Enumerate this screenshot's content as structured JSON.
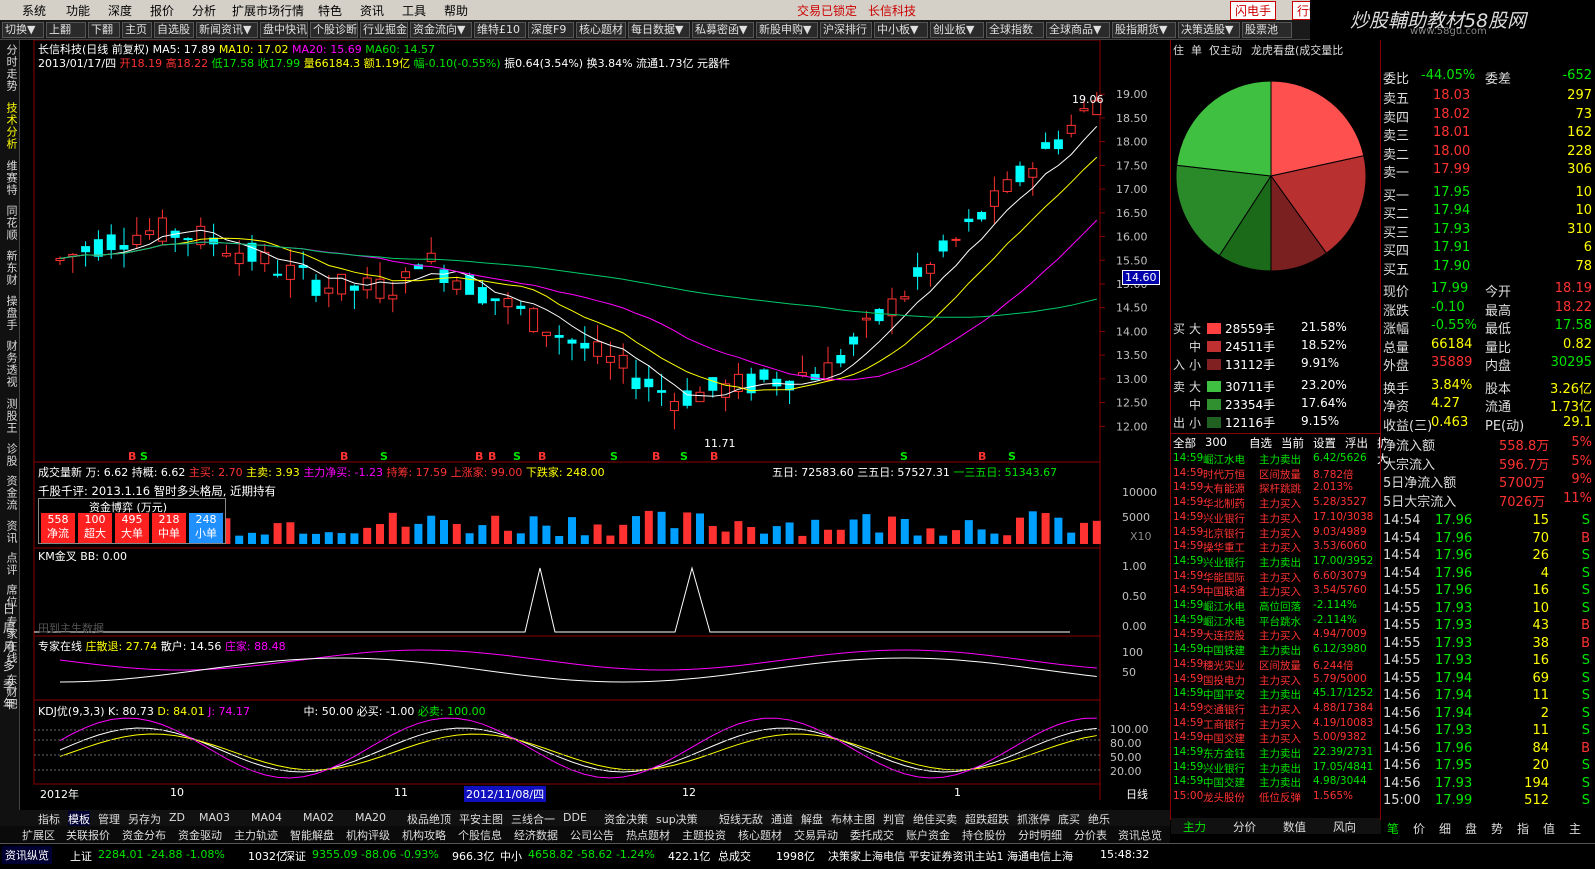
{
  "menu": [
    "系统",
    "功能",
    "深度",
    "报价",
    "分析",
    "扩展市场行情",
    "特色",
    "资讯",
    "工具",
    "帮助"
  ],
  "menu_right": {
    "trade_status": "交易已锁定",
    "stock_name": "长信科技",
    "flash": "闪电手",
    "action": "行情"
  },
  "brand": {
    "text": "炒股輔助教材58股网",
    "url": "www.58gu.com"
  },
  "toolbar": [
    "切换▼",
    "上翻",
    "下翻",
    "主页",
    "自选股",
    "新闻资讯▼",
    "盘中快讯",
    "个股诊断",
    "行业掘金",
    "资金流向▼",
    "维特£10",
    "深度F9",
    "核心题材",
    "每日数据▼",
    "私募密函▼",
    "新股申购▼",
    "沪深排行",
    "中小板▼",
    "创业板▼",
    "全球指数",
    "全球商品▼",
    "股指期货▼",
    "决策选股▼",
    "股票池"
  ],
  "side_tabs": [
    "分时走势",
    "技术分析",
    "维赛特",
    "同花顺",
    "新东财",
    "操盘手",
    "财务透视",
    "测股王",
    "诊股",
    "资金流",
    "资讯",
    "点评",
    "席位",
    "专家在线",
    "东财吧"
  ],
  "side_tabs2": [
    "日",
    "周",
    "月",
    "多",
    "季",
    "年"
  ],
  "chart": {
    "title_line": "长信科技(日线 前复权)",
    "ma5": "MA5: 17.89",
    "ma10": "MA10: 17.02",
    "ma20": "MA20: 15.69",
    "ma60": "MA60: 14.57",
    "info_date": "2013/01/17/四",
    "info_open": "开18.19",
    "info_high": "高18.22",
    "info_low": "低17.58",
    "info_close": "收17.99",
    "info_vol": "量66184.3",
    "info_amt": "额1.19亿",
    "info_chg": "幅-0.10(-0.55%)",
    "info_rest": "振0.64(3.54%) 换3.84% 流通1.73亿 元器件",
    "price_ticks": [
      "19.00",
      "18.50",
      "18.00",
      "17.50",
      "17.00",
      "16.50",
      "16.00",
      "15.50",
      "15.00",
      "14.50",
      "14.00",
      "13.50",
      "13.00",
      "12.50",
      "12.00"
    ],
    "current_price": "14.60",
    "max_label": "19.06",
    "min_label": "11.71",
    "vol_title": "成交量新",
    "vol_wan": "万: 6.62",
    "vol_hold": "持概: 6.62",
    "vol_main": "主买: 2.70",
    "vol_mainsell": "主卖: 3.93",
    "vol_net": "主力净买: -1.23",
    "vol_cash": "持筹: 17.59",
    "vol_up": "上涨家: 99.00",
    "vol_down": "下跌家: 248.00",
    "vol_5d": "五日: 72583.60",
    "vol_35d": "三五日: 57527.31",
    "vol_135d": "一三五日: 51343.67",
    "vol_ticks": [
      "10000",
      "5000"
    ],
    "vol_mult": "X10",
    "news_line": "千股千评: 2013.1.16 智时多头格局, 近期持有",
    "fund_box": {
      "title": "资金博弈 (万元)",
      "cells": [
        {
          "v": "558",
          "l": "净流"
        },
        {
          "v": "100",
          "l": "超大"
        },
        {
          "v": "495",
          "l": "大单"
        },
        {
          "v": "218",
          "l": "中单"
        },
        {
          "v": "248",
          "l": "小单"
        }
      ]
    },
    "km_title": "KM金叉",
    "km_bb": "BB: 0.00",
    "km_ticks": [
      "1.00",
      "0.50",
      "0.00"
    ],
    "km_note": "田到主生数据",
    "expert_title": "专家在线",
    "expert_zz": "庄散退: 27.74",
    "expert_sh": "散户: 14.56",
    "expert_zj": "庄家: 88.48",
    "expert_ticks": [
      "100",
      "50"
    ],
    "kdj_title": "KDJ优(9,3,3)",
    "kdj_k": "K: 80.73",
    "kdj_d": "D: 84.01",
    "kdj_j": "J: 74.17",
    "kdj_mid": "中: 50.00",
    "kdj_buy": "必买: -1.00",
    "kdj_buy2": "必卖: 100.00",
    "kdj_ticks": [
      "100.00",
      "80.00",
      "50.00",
      "20.00"
    ],
    "x_labels": [
      "2012年",
      "10",
      "11",
      "12",
      "1"
    ],
    "x_selected": "2012/11/08/四",
    "x_period": "日线"
  },
  "bs_markers": [
    "B",
    "S",
    "B",
    "S",
    "B",
    "B",
    "S",
    "B",
    "S",
    "B",
    "S",
    "B",
    "S",
    "B",
    "S"
  ],
  "right_panel": {
    "tabs": [
      "住",
      "单",
      "仅主动",
      "龙虎看盘(成交量比"
    ],
    "flows": [
      {
        "side": "买",
        "size": "大",
        "val": "28559手",
        "pct": "21.58%",
        "c": "#ff4040"
      },
      {
        "side": "",
        "size": "中",
        "val": "24511手",
        "pct": "18.52%",
        "c": "#c03030"
      },
      {
        "side": "入",
        "size": "小",
        "val": "13112手",
        "pct": "9.91%",
        "c": "#802020"
      },
      {
        "side": "卖",
        "size": "大",
        "val": "30711手",
        "pct": "23.20%",
        "c": "#40c040"
      },
      {
        "side": "",
        "size": "中",
        "val": "23354手",
        "pct": "17.64%",
        "c": "#309030"
      },
      {
        "side": "出",
        "size": "小",
        "val": "12116手",
        "pct": "9.15%",
        "c": "#206020"
      }
    ],
    "pie_pcts": [
      21.58,
      18.52,
      9.91,
      9.15,
      17.64,
      23.2
    ],
    "filter_tabs": [
      "全部",
      "300",
      "自选",
      "当前",
      "设置",
      "浮出",
      "扩大"
    ],
    "alerts": [
      [
        "14:59",
        "崛江水电",
        "主力卖出",
        "6.42/5626"
      ],
      [
        "14:59",
        "时代万恒",
        "区间放量",
        "8.782倍"
      ],
      [
        "14:59",
        "大有能源",
        "探杆跳跳",
        "2.013%"
      ],
      [
        "14:59",
        "华北制药",
        "主力买入",
        "5.28/3527"
      ],
      [
        "14:59",
        "兴业银行",
        "主力买入",
        "17.10/3038"
      ],
      [
        "14:59",
        "北京银行",
        "主力买入",
        "9.03/4989"
      ],
      [
        "14:59",
        "操华重工",
        "主力买入",
        "3.53/6060"
      ],
      [
        "14:59",
        "兴业银行",
        "主力卖出",
        "17.00/3952"
      ],
      [
        "14:59",
        "华能国际",
        "主力买入",
        "6.60/3079"
      ],
      [
        "14:59",
        "中国联通",
        "主力买入",
        "3.54/5760"
      ],
      [
        "14:59",
        "崛江水电",
        "高位回落",
        "-2.114%"
      ],
      [
        "14:59",
        "崛江水电",
        "平台跳水",
        "-2.114%"
      ],
      [
        "14:59",
        "大连控股",
        "主力买入",
        "4.94/7009"
      ],
      [
        "14:59",
        "中国铁建",
        "主力卖出",
        "6.12/3980"
      ],
      [
        "14:59",
        "穗光实业",
        "区间放量",
        "6.244倍"
      ],
      [
        "14:59",
        "国投电力",
        "主力买入",
        "5.79/5000"
      ],
      [
        "14:59",
        "中国平安",
        "主力卖出",
        "45.17/1252"
      ],
      [
        "14:59",
        "交通银行",
        "主力买入",
        "4.88/17384"
      ],
      [
        "14:59",
        "工商银行",
        "主力买入",
        "4.19/10083"
      ],
      [
        "14:59",
        "中国交建",
        "主力买入",
        "5.00/9382"
      ],
      [
        "14:59",
        "东方金钰",
        "主力卖出",
        "22.39/2731"
      ],
      [
        "14:59",
        "兴业银行",
        "主力卖出",
        "17.05/4841"
      ],
      [
        "14:59",
        "中国交建",
        "主力卖出",
        "4.98/3044"
      ],
      [
        "15:00",
        "龙头股份",
        "低位反弹",
        "1.565%"
      ]
    ],
    "bottom_tabs": [
      "主力",
      "分价",
      "数值",
      "风向"
    ]
  },
  "quote": {
    "header": "委比",
    "header_val": "-44.05%",
    "header_lbl2": "委差",
    "header_val2": "-652",
    "asks": [
      [
        "卖五",
        "18.03",
        "297"
      ],
      [
        "卖四",
        "18.02",
        "73"
      ],
      [
        "卖三",
        "18.01",
        "162"
      ],
      [
        "卖二",
        "18.00",
        "228"
      ],
      [
        "卖一",
        "17.99",
        "306"
      ]
    ],
    "bids": [
      [
        "买一",
        "17.95",
        "10"
      ],
      [
        "买二",
        "17.94",
        "10"
      ],
      [
        "买三",
        "17.93",
        "310"
      ],
      [
        "买四",
        "17.91",
        "6"
      ],
      [
        "买五",
        "17.90",
        "78"
      ]
    ],
    "stats": [
      [
        "现价",
        "17.99",
        "今开",
        "18.19"
      ],
      [
        "涨跌",
        "-0.10",
        "最高",
        "18.22"
      ],
      [
        "涨幅",
        "-0.55%",
        "最低",
        "17.58"
      ],
      [
        "总量",
        "66184",
        "量比",
        "0.82"
      ],
      [
        "外盘",
        "35889",
        "内盘",
        "30295"
      ]
    ],
    "stats2": [
      [
        "换手",
        "3.84%",
        "股本",
        "3.26亿"
      ],
      [
        "净资",
        "4.27",
        "流通",
        "1.73亿"
      ],
      [
        "收益(三)",
        "0.463",
        "PE(动)",
        "29.1"
      ]
    ],
    "flows": [
      [
        "净流入额",
        "558.8万",
        "5%"
      ],
      [
        "大宗流入",
        "596.7万",
        "5%"
      ],
      [
        "5日净流入额",
        "5700万",
        "9%"
      ],
      [
        "5日大宗流入",
        "7026万",
        "11%"
      ]
    ],
    "ticks": [
      [
        "14:54",
        "17.96",
        "15",
        "S"
      ],
      [
        "14:54",
        "17.96",
        "70",
        "B"
      ],
      [
        "14:54",
        "17.96",
        "26",
        "S"
      ],
      [
        "14:54",
        "17.96",
        "4",
        "S"
      ],
      [
        "14:55",
        "17.96",
        "16",
        "S"
      ],
      [
        "14:55",
        "17.93",
        "10",
        "S"
      ],
      [
        "14:55",
        "17.93",
        "43",
        "B"
      ],
      [
        "14:55",
        "17.93",
        "38",
        "B"
      ],
      [
        "14:55",
        "17.93",
        "16",
        "S"
      ],
      [
        "14:55",
        "17.94",
        "69",
        "S"
      ],
      [
        "14:56",
        "17.94",
        "11",
        "S"
      ],
      [
        "14:56",
        "17.94",
        "2",
        "S"
      ],
      [
        "14:56",
        "17.93",
        "11",
        "S"
      ],
      [
        "14:56",
        "17.96",
        "84",
        "B"
      ],
      [
        "14:56",
        "17.95",
        "20",
        "S"
      ],
      [
        "14:56",
        "17.93",
        "194",
        "S"
      ],
      [
        "15:00",
        "17.99",
        "512",
        "S"
      ]
    ],
    "bottom_tabs": [
      "笔",
      "价",
      "细",
      "盘",
      "势",
      "指",
      "值",
      "主"
    ]
  },
  "bottom_tabs": [
    "指标",
    "模板",
    "管理",
    "另存为",
    "ZD",
    "MA03",
    "MA04",
    "MA02",
    "MA20",
    "极品绝顶",
    "平安主图",
    "三线合一",
    "DDE",
    "资金决策",
    "sup决策",
    "短线无敌",
    "通道",
    "解盘",
    "布林主图",
    "判官",
    "绝佳买卖",
    "超跌超跌",
    "抓涨停",
    "底买",
    "绝乐"
  ],
  "bottom_tabs2": [
    "扩展区",
    "关联报价",
    "资金分布",
    "资金驱动",
    "主力轨迹",
    "智能解盘",
    "机构评级",
    "机构攻略",
    "个股信息",
    "经济数据",
    "公司公告",
    "热点题材",
    "主题投资",
    "核心题材",
    "交易异动",
    "委托成交",
    "账户资金",
    "持仓股份",
    "分时明细",
    "分价表",
    "资讯总览"
  ],
  "status": {
    "label": "资讯纵览",
    "sh": "上证",
    "sh_vals": "2284.01 -24.88 -1.08%",
    "sh_amt": "1032亿",
    "sz": "深证",
    "sz_vals": "9355.09 -88.06 -0.93%",
    "sz_amt": "966.3亿",
    "zx": "中小",
    "zx_vals": "4658.82 -58.62 -1.24%",
    "zx_amt": "422.1亿",
    "total": "总成交",
    "total_amt": "1998亿",
    "msg": "决策家上海电信 平安证券资讯主站1 海通电信上海",
    "time": "15:48:32"
  }
}
